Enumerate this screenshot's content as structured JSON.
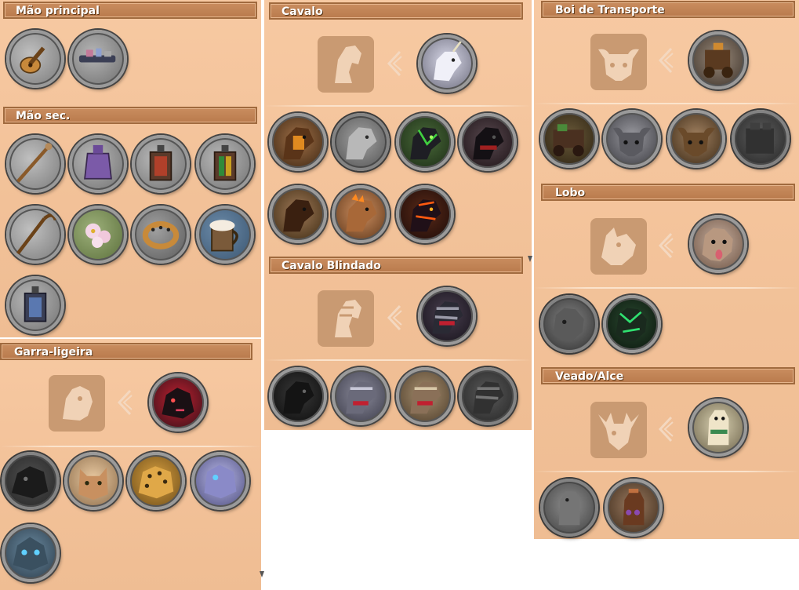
{
  "sections": {
    "main_hand": {
      "title": "Mão principal"
    },
    "off_hand": {
      "title": "Mão sec."
    },
    "swiftclaw": {
      "title": "Garra-ligeira"
    },
    "horse": {
      "title": "Cavalo"
    },
    "armored_horse": {
      "title": "Cavalo Blindado"
    },
    "ox": {
      "title": "Boi de Transporte"
    },
    "wolf": {
      "title": "Lobo"
    },
    "deer": {
      "title": "Veado/Alce"
    }
  },
  "items": {
    "main_hand": [
      "lute-icon",
      "crossbow-icon"
    ],
    "off_hand": [
      "staff-icon",
      "lantern-purple-icon",
      "lantern-red-icon",
      "lantern-green-icon",
      "crook-icon",
      "flower-icon",
      "ring-icon",
      "tankard-icon",
      "lantern-blue-icon"
    ],
    "swiftclaw": [
      "black-panther-icon",
      "lynx-icon",
      "jaguar-icon",
      "spirit-cat-icon",
      "frost-cat-icon"
    ],
    "horse": [
      "brown-horse-icon",
      "gray-horse-icon",
      "green-horse-icon",
      "black-horse-icon",
      "dark-horse-icon",
      "fire-horse-icon",
      "lava-horse-icon"
    ],
    "armored_horse": [
      "black-armored-horse-icon",
      "armored-horse-1-icon",
      "armored-horse-2-icon",
      "armored-horse-3-icon"
    ],
    "ox": [
      "cart-ox-icon",
      "gray-ox-icon",
      "brown-ox-icon",
      "stone-ox-icon"
    ],
    "wolf": [
      "gray-wolf-icon",
      "spectral-wolf-icon"
    ],
    "deer": [
      "stag-icon",
      "moose-icon"
    ]
  },
  "colors": {
    "panel": "#f2c198",
    "header": "#b97a4d",
    "header_border": "#a06a3e",
    "silhouette": "#c99a72"
  }
}
